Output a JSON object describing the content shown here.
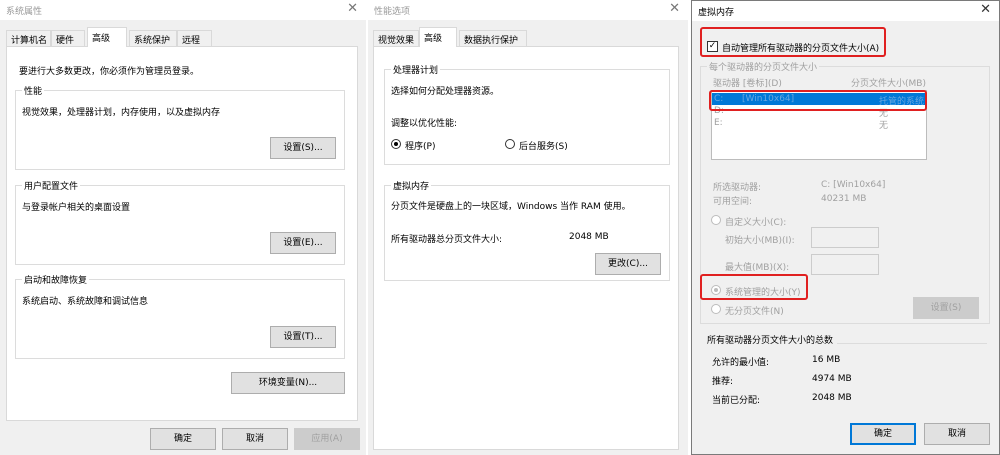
{
  "sysprops": {
    "title": "系统属性",
    "tabs": [
      "计算机名",
      "硬件",
      "高级",
      "系统保护",
      "远程"
    ],
    "admin_note": "要进行大多数更改，你必须作为管理员登录。",
    "performance": {
      "title": "性能",
      "desc": "视觉效果，处理器计划，内存使用，以及虚拟内存",
      "button": "设置(S)..."
    },
    "profiles": {
      "title": "用户配置文件",
      "desc": "与登录帐户相关的桌面设置",
      "button": "设置(E)..."
    },
    "startup": {
      "title": "启动和故障恢复",
      "desc": "系统启动、系统故障和调试信息",
      "button": "设置(T)..."
    },
    "env_button": "环境变量(N)...",
    "ok": "确定",
    "cancel": "取消",
    "apply": "应用(A)"
  },
  "perfopts": {
    "title": "性能选项",
    "tabs": [
      "视觉效果",
      "高级",
      "数据执行保护"
    ],
    "scheduling": {
      "title": "处理器计划",
      "desc": "选择如何分配处理器资源。",
      "adjust_label": "调整以优化性能:",
      "programs": "程序(P)",
      "services": "后台服务(S)"
    },
    "vm": {
      "title": "虚拟内存",
      "desc": "分页文件是硬盘上的一块区域，Windows 当作 RAM 使用。",
      "total_label": "所有驱动器总分页文件大小:",
      "total_value": "2048 MB",
      "change_button": "更改(C)..."
    }
  },
  "virtmem": {
    "title": "虚拟内存",
    "auto_manage": "自动管理所有驱动器的分页文件大小(A)",
    "per_drive_title": "每个驱动器的分页文件大小",
    "col_drive": "驱动器 [卷标](D)",
    "col_size": "分页文件大小(MB)",
    "drives": [
      {
        "drive": "C:",
        "label": "[Win10x64]",
        "size": "托管的系统"
      },
      {
        "drive": "D:",
        "label": "",
        "size": "无"
      },
      {
        "drive": "E:",
        "label": "",
        "size": "无"
      }
    ],
    "selected_drive_label": "所选驱动器:",
    "selected_drive_value": "C:  [Win10x64]",
    "free_space_label": "可用空间:",
    "free_space_value": "40231 MB",
    "custom_size": "自定义大小(C):",
    "initial_size": "初始大小(MB)(I):",
    "max_size": "最大值(MB)(X):",
    "system_managed": "系统管理的大小(Y)",
    "no_paging": "无分页文件(N)",
    "set_button": "设置(S)",
    "totals_title": "所有驱动器分页文件大小的总数",
    "min_allowed_label": "允许的最小值:",
    "min_allowed_value": "16 MB",
    "recommended_label": "推荐:",
    "recommended_value": "4974 MB",
    "allocated_label": "当前已分配:",
    "allocated_value": "2048 MB",
    "ok": "确定",
    "cancel": "取消"
  },
  "colors": {
    "highlight": "#0078d7",
    "annotation_red": "#e02020",
    "window_bg": "#f0f0f0"
  }
}
